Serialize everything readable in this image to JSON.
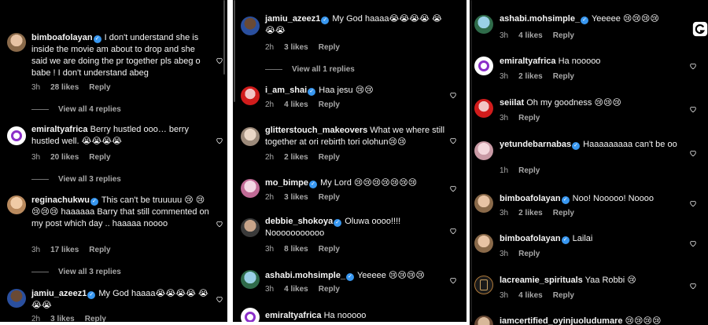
{
  "icons": {
    "heart": "heart-outline-icon",
    "verified": "verified-badge-icon",
    "corner": "g-logo-icon"
  },
  "colors": {
    "background": "#000000",
    "text": "#f5f5f5",
    "meta": "#a8a8a8",
    "verified": "#3897f0"
  },
  "verified_mark": "✓",
  "panel1": {
    "c1": {
      "username": "bimboafolayan",
      "text": " I don't understand she is inside the movie am about to drop and she said we are doing the pr together pls abeg o babe ! I don't understand abeg",
      "time": "3h",
      "likes": "28 likes",
      "reply": "Reply"
    },
    "view1": "View all 4 replies",
    "c2": {
      "username": "emiraltyafrica",
      "text": " Berry hustled ooo… berry hustled well. 😭😭😭😭",
      "time": "3h",
      "likes": "20 likes",
      "reply": "Reply"
    },
    "view2": "View all 3 replies",
    "c3": {
      "username": "reginachukwu",
      "text": " This can't be truuuuu 😢 😢😢😢😢 haaaaaa Barry that still commented on my post which day .. haaaaa noooo",
      "time": "3h",
      "likes": "17 likes",
      "reply": "Reply"
    },
    "view3": "View all 3 replies",
    "c4": {
      "username": "jamiu_azeez1",
      "text": " My God haaaa😭😭😭😭 😭😭😭",
      "time": "2h",
      "likes": "3 likes",
      "reply": "Reply"
    }
  },
  "panel2": {
    "c1": {
      "username": "jamiu_azeez1",
      "text": " My God haaaa😭😭😭😭 😭😭😭",
      "time": "2h",
      "likes": "3 likes",
      "reply": "Reply"
    },
    "view1": "View all 1 replies",
    "c2": {
      "username": "i_am_shai",
      "text": " Haa jesu 😢😢",
      "time": "2h",
      "likes": "4 likes",
      "reply": "Reply"
    },
    "c3": {
      "username": "glitterstouch_makeovers",
      "text": " What we where still together at ori rebirth tori olohun😢😢",
      "time": "2h",
      "likes": "2 likes",
      "reply": "Reply"
    },
    "c4": {
      "username": "mo_bimpe",
      "text": " My Lord 😢😢😢😢😢😢😢",
      "time": "2h",
      "likes": "3 likes",
      "reply": "Reply"
    },
    "c5": {
      "username": "debbie_shokoya",
      "text": " Oluwa oooo!!!! Nooooooooooo",
      "time": "3h",
      "likes": "8 likes",
      "reply": "Reply"
    },
    "c6": {
      "username": "ashabi.mohsimple_",
      "text": " Yeeeee 😢😢😢😢",
      "time": "3h",
      "likes": "4 likes",
      "reply": "Reply"
    },
    "c7": {
      "username": "emiraltyafrica",
      "text": " Ha nooooo"
    }
  },
  "panel3": {
    "c1": {
      "username": "ashabi.mohsimple_",
      "text": " Yeeeee 😢😢😢😢",
      "time": "3h",
      "likes": "4 likes",
      "reply": "Reply"
    },
    "c2": {
      "username": "emiraltyafrica",
      "text": " Ha nooooo",
      "time": "3h",
      "likes": "2 likes",
      "reply": "Reply"
    },
    "c3": {
      "username": "seiilat",
      "text": " Oh my goodness 😢😢😢",
      "time": "3h",
      "reply": "Reply"
    },
    "c4": {
      "username": "yetundebarnabas",
      "text": " Haaaaaaaaa can't be oo",
      "time": "1h",
      "reply": "Reply"
    },
    "c5": {
      "username": "bimboafolayan",
      "text": " Noo! Nooooo! Noooo",
      "time": "3h",
      "likes": "2 likes",
      "reply": "Reply"
    },
    "c6": {
      "username": "bimboafolayan",
      "text": " Lailai",
      "time": "3h",
      "reply": "Reply"
    },
    "c7": {
      "username": "lacreamie_spirituals",
      "text": " Yaa Robbi 😢",
      "time": "3h",
      "likes": "4 likes",
      "reply": "Reply"
    },
    "c8": {
      "username": "iamcertified_oyinjuoludumare",
      "text": " 😢😢😢😢"
    }
  }
}
